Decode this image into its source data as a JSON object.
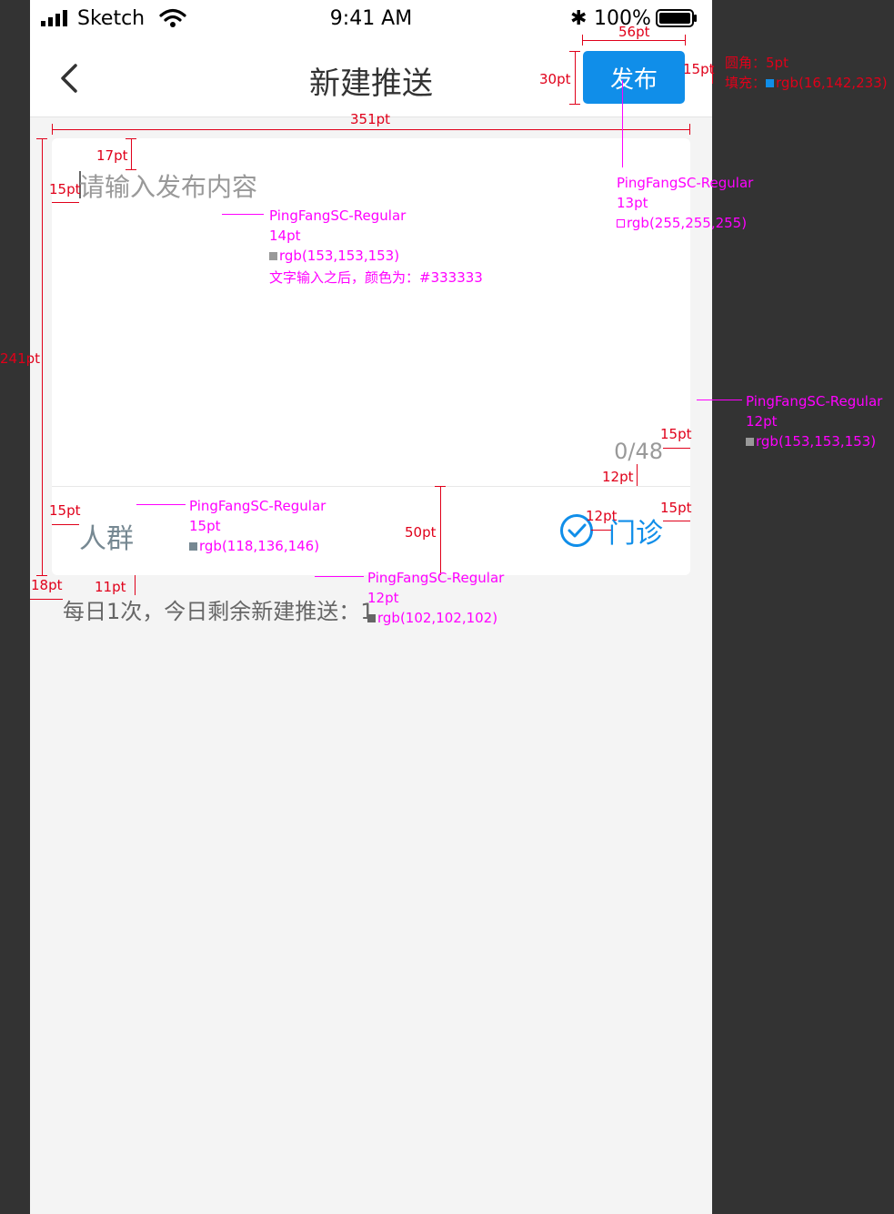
{
  "status_bar": {
    "carrier": "Sketch",
    "time": "9:41 AM",
    "battery": "100%"
  },
  "nav": {
    "title": "新建推送",
    "publish_label": "发布"
  },
  "editor": {
    "placeholder": "请输入发布内容",
    "counter": "0/48"
  },
  "footer": {
    "crowd_label": "人群",
    "clinic_label": "门诊"
  },
  "quota_text": "每日1次，今日剩余新建推送：1",
  "colors": {
    "accent": "#108ee9",
    "placeholder": "#999999",
    "crowd": "#768892",
    "quota": "#666666",
    "page_bg": "#f4f4f4"
  },
  "icons": [
    "back-chevron-icon",
    "signal-icon",
    "wifi-icon",
    "bluetooth-icon",
    "battery-icon",
    "check-circle-icon"
  ],
  "annotations": {
    "w56": "56pt",
    "h30": "30pt",
    "m15_btn": "15pt",
    "radius": "圆角：5pt",
    "fill": "填充：",
    "fill_rgb": "rgb(16,142,233)",
    "w351": "351pt",
    "m17": "17pt",
    "m15_left": "15pt",
    "h241": "241pt",
    "ph_font": "PingFangSC-Regular",
    "ph_size": "14pt",
    "ph_color": "rgb(153,153,153)",
    "ph_note": "文字输入之后，颜色为：#333333",
    "btn_font": "PingFangSC-Regular",
    "btn_size": "13pt",
    "btn_color": "rgb(255,255,255)",
    "cnt_font": "PingFangSC-Regular",
    "cnt_size": "12pt",
    "cnt_color": "rgb(153,153,153)",
    "cnt_m15": "15pt",
    "cnt_m12": "12pt",
    "crowd_m15": "15pt",
    "crowd_font": "PingFangSC-Regular",
    "crowd_size": "15pt",
    "crowd_color": "rgb(118,136,146)",
    "h50": "50pt",
    "clinic_m12": "12pt",
    "clinic_m15": "15pt",
    "m18": "18pt",
    "m11": "11pt",
    "quota_font": "PingFangSC-Regular",
    "quota_size": "12pt",
    "quota_color": "rgb(102,102,102)"
  }
}
